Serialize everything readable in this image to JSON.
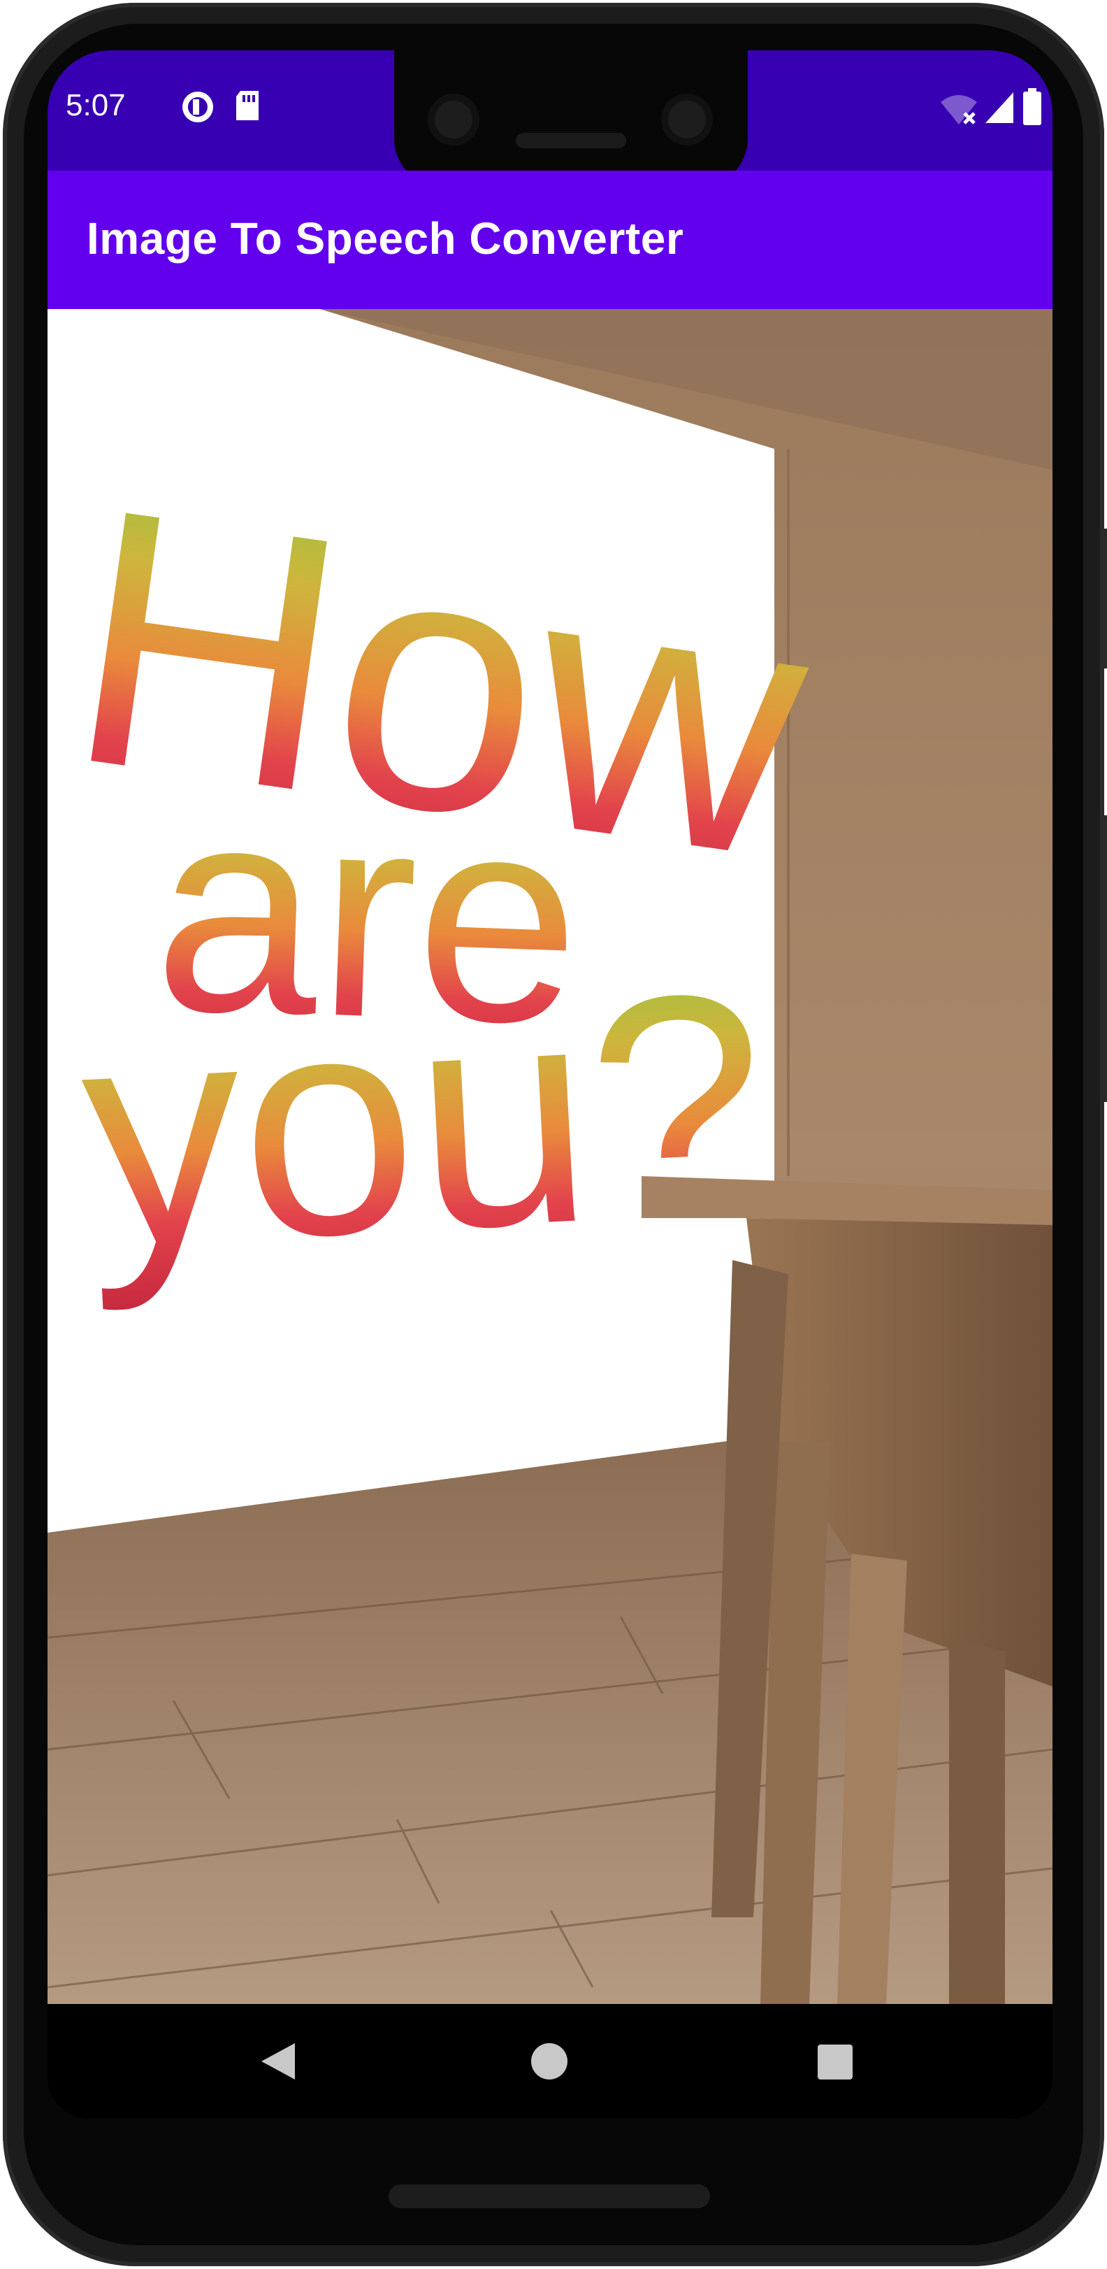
{
  "status_bar": {
    "time": "5:07",
    "icons_left": [
      "data-saver-icon",
      "sd-card-icon"
    ],
    "icons_right": [
      "wifi-off-icon",
      "signal-icon",
      "battery-icon"
    ]
  },
  "app_bar": {
    "title": "Image To Speech Converter"
  },
  "image": {
    "text_lines": [
      "How",
      "are",
      "you?"
    ],
    "description_colors": {
      "gradient_top": "#8dc63f",
      "gradient_mid": "#e98a3c",
      "gradient_bottom": "#c6283e",
      "app_bar": "#6200ee",
      "status_bar": "#3700b3"
    }
  },
  "nav_bar": {
    "buttons": [
      "back-icon",
      "home-icon",
      "recents-icon"
    ]
  }
}
